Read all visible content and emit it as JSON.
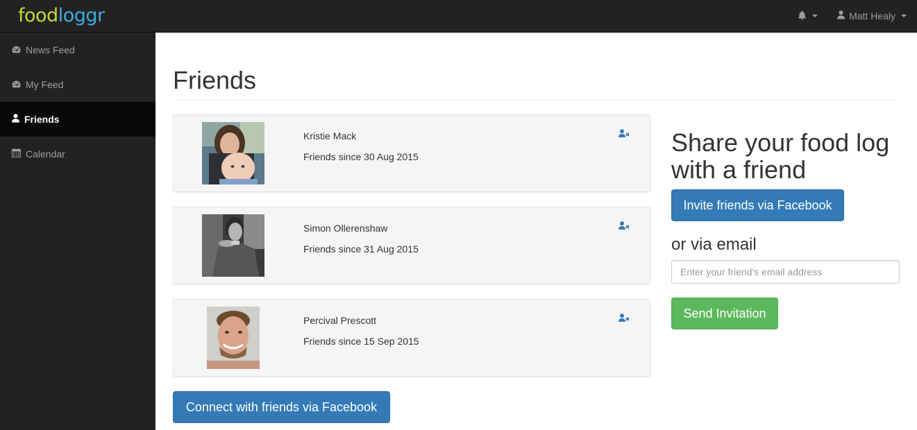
{
  "app": {
    "logo_food": "food",
    "logo_loggr": "loggr"
  },
  "navbar": {
    "notifications_icon": "bell-icon",
    "user_icon": "user-icon",
    "user_name": "Matt Healy"
  },
  "sidebar": {
    "items": [
      {
        "label": "News Feed",
        "icon": "dashboard-icon",
        "active": false
      },
      {
        "label": "My Feed",
        "icon": "dashboard-icon",
        "active": false
      },
      {
        "label": "Friends",
        "icon": "user-icon",
        "active": true
      },
      {
        "label": "Calendar",
        "icon": "calendar-icon",
        "active": false
      }
    ]
  },
  "main": {
    "page_title": "Friends",
    "friends": [
      {
        "name": "Kristie Mack",
        "since": "Friends since 30 Aug 2015",
        "remove_icon": "remove-friend-icon"
      },
      {
        "name": "Simon Ollerenshaw",
        "since": "Friends since 31 Aug 2015",
        "remove_icon": "remove-friend-icon"
      },
      {
        "name": "Percival Prescott",
        "since": "Friends since 15 Sep 2015",
        "remove_icon": "remove-friend-icon"
      }
    ],
    "connect_facebook_label": "Connect with friends via Facebook"
  },
  "share": {
    "heading": "Share your food log with a friend",
    "invite_facebook_label": "Invite friends via Facebook",
    "email_heading": "or via email",
    "email_placeholder": "Enter your friend's email address",
    "email_value": "",
    "send_label": "Send Invitation"
  },
  "colors": {
    "navbar_bg": "#222222",
    "sidebar_active_bg": "#080808",
    "primary": "#337ab7",
    "success": "#5cb85c",
    "logo_green": "#c6d836",
    "logo_blue": "#3fa9e0"
  }
}
